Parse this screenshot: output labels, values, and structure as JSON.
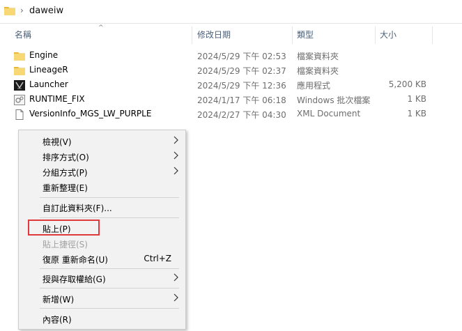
{
  "address": {
    "path": "daweiw"
  },
  "columns": {
    "name": "名稱",
    "date": "修改日期",
    "type": "類型",
    "size": "大小"
  },
  "files": [
    {
      "name": "Engine",
      "date": "2024/5/29 下午 02:53",
      "type": "檔案資料夾",
      "size": "",
      "icon": "folder-icon"
    },
    {
      "name": "LineageR",
      "date": "2024/5/29 下午 02:37",
      "type": "檔案資料夾",
      "size": "",
      "icon": "folder-icon"
    },
    {
      "name": "Launcher",
      "date": "2024/5/29 下午 12:36",
      "type": "應用程式",
      "size": "5,200 KB",
      "icon": "app-icon"
    },
    {
      "name": "RUNTIME_FIX",
      "date": "2024/1/17 下午 06:18",
      "type": "Windows 批次檔案",
      "size": "1 KB",
      "icon": "batch-file-icon"
    },
    {
      "name": "VersionInfo_MGS_LW_PURPLE",
      "date": "2024/2/27 下午 04:30",
      "type": "XML Document",
      "size": "1 KB",
      "icon": "document-icon"
    }
  ],
  "menu": {
    "view": "檢視(V)",
    "sort": "排序方式(O)",
    "group": "分組方式(P)",
    "refresh": "重新整理(E)",
    "customize": "自訂此資料夾(F)...",
    "paste": "貼上(P)",
    "paste_shortcut": "貼上捷徑(S)",
    "undo_rename": "復原 重新命名(U)",
    "undo_shortcut": "Ctrl+Z",
    "give_access": "授與存取權給(G)",
    "new": "新增(W)",
    "properties": "內容(R)"
  },
  "colors": {
    "folder": "#f8d775",
    "highlight": "#e0393b",
    "header_text": "#4c607a"
  }
}
